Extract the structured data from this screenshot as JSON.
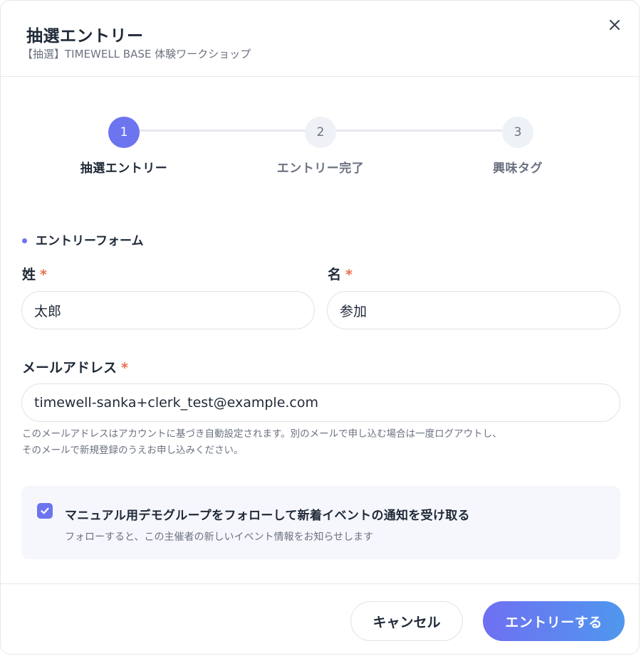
{
  "dialog": {
    "title": "抽選エントリー",
    "subtitle": "【抽選】TIMEWELL BASE 体験ワークショップ",
    "close_icon": "close-icon"
  },
  "stepper": {
    "steps": [
      {
        "number": "1",
        "label": "抽選エントリー",
        "state": "active"
      },
      {
        "number": "2",
        "label": "エントリー完了",
        "state": "inactive"
      },
      {
        "number": "3",
        "label": "興味タグ",
        "state": "inactive"
      }
    ]
  },
  "form": {
    "section_title": "エントリーフォーム",
    "required_mark": "*",
    "last_name": {
      "label": "姓",
      "value": "太郎"
    },
    "first_name": {
      "label": "名",
      "value": "参加"
    },
    "email": {
      "label": "メールアドレス",
      "value": "timewell-sanka+clerk_test@example.com"
    },
    "email_helper_line1": "このメールアドレスはアカウントに基づき自動設定されます。別のメールで申し込む場合は一度ログアウトし、",
    "email_helper_line2": "そのメールで新規登録のうえお申し込みください。",
    "follow": {
      "checked": true,
      "label": "マニュアル用デモグループをフォローして新着イベントの通知を受け取る",
      "description": "フォローすると、この主催者の新しいイベント情報をお知らせします"
    }
  },
  "footer": {
    "cancel_label": "キャンセル",
    "submit_label": "エントリーする"
  },
  "colors": {
    "accent": "#6d74f0",
    "required": "#ef6a4a",
    "button_gradient_start": "#6f70f2",
    "button_gradient_end": "#4f97ee"
  }
}
